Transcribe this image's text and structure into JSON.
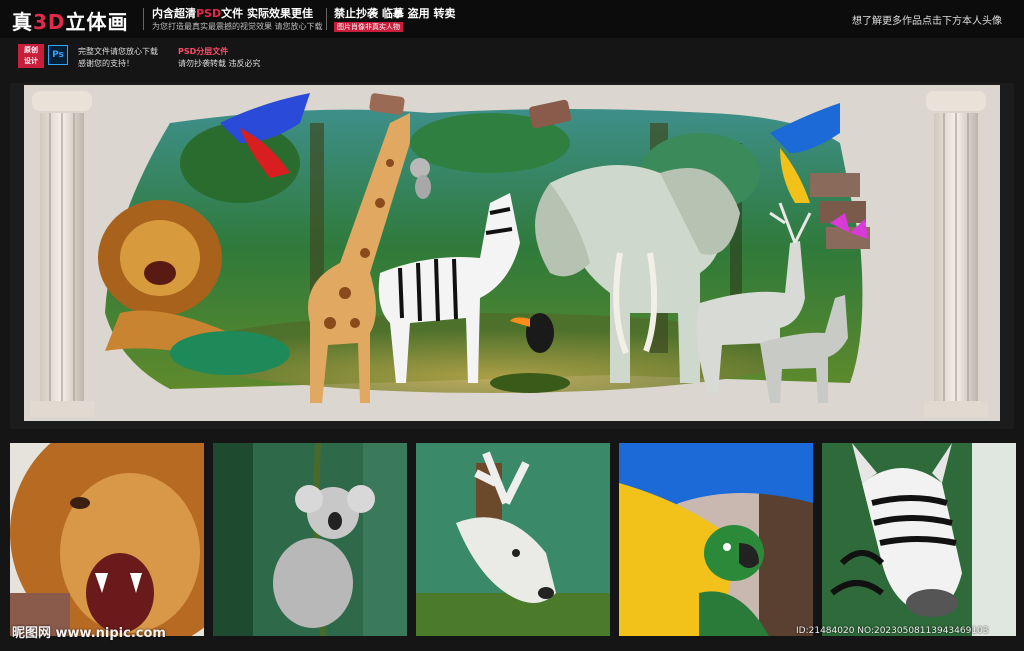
{
  "header": {
    "brand_prefix": "真",
    "brand_accent": "3D",
    "brand_suffix": "立体画",
    "tag1_prefix": "内含超清",
    "tag1_accent": "PSD",
    "tag1_suffix": "文件 实际效果更佳",
    "tag1_sub": "为您打造最真实最震撼的视觉效果 请您放心下载",
    "tag2": "禁止抄袭 临摹 盗用 转卖",
    "tag2_sub": "图片肖像非真实人物",
    "right_text": "想了解更多作品点击下方本人头像"
  },
  "info": {
    "badge_line1": "原创",
    "badge_line2": "设计",
    "ps_label": "Ps",
    "line1": "完整文件请您放心下载",
    "line2": "感谢您的支持！",
    "psd_title": "PSD分层文件",
    "psd_line": "请勿抄袭转载 违反必究"
  },
  "footer": {
    "logo": "昵图网 www.nipic.com",
    "id": "ID:21484020 NO:20230508113943469103"
  },
  "colors": {
    "accent": "#e22a4a",
    "wall": "#dcd6d0",
    "jungle": "#2f7a3a",
    "background": "#151515"
  },
  "thumbnails": [
    "lion-closeup",
    "koala-closeup",
    "deer-closeup",
    "parrot-closeup",
    "zebra-closeup"
  ]
}
